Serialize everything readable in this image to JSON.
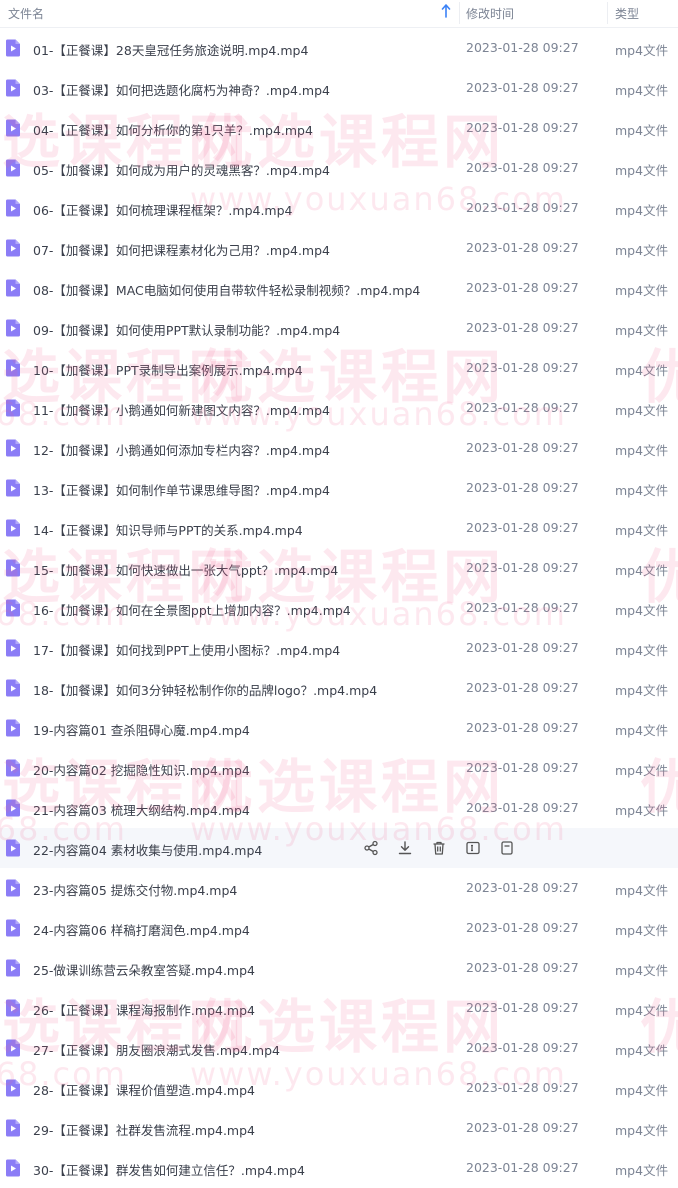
{
  "header": {
    "name_label": "文件名",
    "time_label": "修改时间",
    "type_label": "类型",
    "sort_icon": "arrow-up-icon"
  },
  "files": [
    {
      "name": "01-【正餐课】28天皇冠任务旅途说明.mp4.mp4",
      "time": "2023-01-28 09:27",
      "type": "mp4文件"
    },
    {
      "name": "03-【正餐课】如何把选题化腐朽为神奇？.mp4.mp4",
      "time": "2023-01-28 09:27",
      "type": "mp4文件"
    },
    {
      "name": "04-【正餐课】如何分析你的第1只羊？.mp4.mp4",
      "time": "2023-01-28 09:27",
      "type": "mp4文件"
    },
    {
      "name": "05-【加餐课】如何成为用户的灵魂黑客？.mp4.mp4",
      "time": "2023-01-28 09:27",
      "type": "mp4文件"
    },
    {
      "name": "06-【正餐课】如何梳理课程框架？.mp4.mp4",
      "time": "2023-01-28 09:27",
      "type": "mp4文件"
    },
    {
      "name": "07-【加餐课】如何把课程素材化为己用？.mp4.mp4",
      "time": "2023-01-28 09:27",
      "type": "mp4文件"
    },
    {
      "name": "08-【加餐课】MAC电脑如何使用自带软件轻松录制视频？.mp4.mp4",
      "time": "2023-01-28 09:27",
      "type": "mp4文件"
    },
    {
      "name": "09-【加餐课】如何使用PPT默认录制功能？.mp4.mp4",
      "time": "2023-01-28 09:27",
      "type": "mp4文件"
    },
    {
      "name": "10-【加餐课】PPT录制导出案例展示.mp4.mp4",
      "time": "2023-01-28 09:27",
      "type": "mp4文件"
    },
    {
      "name": "11-【加餐课】小鹅通如何新建图文内容？.mp4.mp4",
      "time": "2023-01-28 09:27",
      "type": "mp4文件"
    },
    {
      "name": "12-【加餐课】小鹅通如何添加专栏内容？.mp4.mp4",
      "time": "2023-01-28 09:27",
      "type": "mp4文件"
    },
    {
      "name": "13-【正餐课】如何制作单节课思维导图？.mp4.mp4",
      "time": "2023-01-28 09:27",
      "type": "mp4文件"
    },
    {
      "name": "14-【正餐课】知识导师与PPT的关系.mp4.mp4",
      "time": "2023-01-28 09:27",
      "type": "mp4文件"
    },
    {
      "name": "15-【加餐课】如何快速做出一张大气ppt？.mp4.mp4",
      "time": "2023-01-28 09:27",
      "type": "mp4文件"
    },
    {
      "name": "16-【加餐课】如何在全景图ppt上增加内容？.mp4.mp4",
      "time": "2023-01-28 09:27",
      "type": "mp4文件"
    },
    {
      "name": "17-【加餐课】如何找到PPT上使用小图标？.mp4.mp4",
      "time": "2023-01-28 09:27",
      "type": "mp4文件"
    },
    {
      "name": "18-【加餐课】如何3分钟轻松制作你的品牌logo？.mp4.mp4",
      "time": "2023-01-28 09:27",
      "type": "mp4文件"
    },
    {
      "name": "19-内容篇01 查杀阻碍心魔.mp4.mp4",
      "time": "2023-01-28 09:27",
      "type": "mp4文件"
    },
    {
      "name": "20-内容篇02 挖掘隐性知识.mp4.mp4",
      "time": "2023-01-28 09:27",
      "type": "mp4文件"
    },
    {
      "name": "21-内容篇03 梳理大纲结构.mp4.mp4",
      "time": "2023-01-28 09:27",
      "type": "mp4文件"
    },
    {
      "name": "22-内容篇04 素材收集与使用.mp4.mp4",
      "time": "",
      "type": "",
      "hover": true
    },
    {
      "name": "23-内容篇05 提炼交付物.mp4.mp4",
      "time": "2023-01-28 09:27",
      "type": "mp4文件"
    },
    {
      "name": "24-内容篇06 样稿打磨润色.mp4.mp4",
      "time": "2023-01-28 09:27",
      "type": "mp4文件"
    },
    {
      "name": "25-做课训练营云朵教室答疑.mp4.mp4",
      "time": "2023-01-28 09:27",
      "type": "mp4文件"
    },
    {
      "name": "26-【正餐课】课程海报制作.mp4.mp4",
      "time": "2023-01-28 09:27",
      "type": "mp4文件"
    },
    {
      "name": "27-【正餐课】朋友圈浪潮式发售.mp4.mp4",
      "time": "2023-01-28 09:27",
      "type": "mp4文件"
    },
    {
      "name": "28-【正餐课】课程价值塑造.mp4.mp4",
      "time": "2023-01-28 09:27",
      "type": "mp4文件"
    },
    {
      "name": "29-【正餐课】社群发售流程.mp4.mp4",
      "time": "2023-01-28 09:27",
      "type": "mp4文件"
    },
    {
      "name": "30-【正餐课】群发售如何建立信任？.mp4.mp4",
      "time": "2023-01-28 09:27",
      "type": "mp4文件"
    }
  ],
  "row_actions": [
    "share-icon",
    "download-icon",
    "delete-icon",
    "rename-icon",
    "more-icon"
  ],
  "watermark": {
    "text": "优选课程网",
    "url": "www.youxuan68.com",
    "color": "#f05a8c"
  },
  "colors": {
    "file_icon": "#8b7cf6",
    "sort_arrow": "#3b82f6",
    "hover_row": "#f5f7fb"
  }
}
